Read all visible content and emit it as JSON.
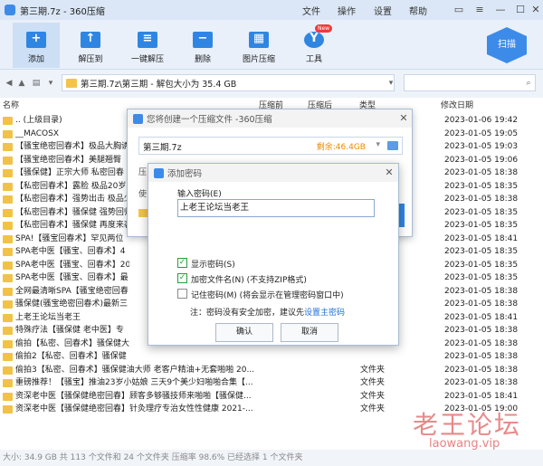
{
  "window": {
    "title": "第三期.7z - 360压缩",
    "menu": [
      "文件",
      "操作",
      "设置",
      "帮助"
    ]
  },
  "toolbar": {
    "buttons": [
      "添加",
      "解压到",
      "一键解压",
      "删除",
      "图片压缩",
      "工具"
    ],
    "new_badge": "New",
    "scan_label": "扫描"
  },
  "address": {
    "path": "第三期.7z\\第三期 - 解包大小为 35.4 GB"
  },
  "list": {
    "headers": [
      "名称",
      "压缩前",
      "压缩后",
      "类型",
      "修改日期"
    ],
    "rows": [
      {
        "name": ".. (上级目录)",
        "type": "",
        "date": "2023-01-06 19:42"
      },
      {
        "name": "__MACOSX",
        "type": "",
        "date": "2023-01-05 19:05"
      },
      {
        "name": "【骚宝绝密回春术】极品大胸诱",
        "type": "",
        "date": "2023-01-05 19:03"
      },
      {
        "name": "【骚宝绝密回春术】美腿翘臀",
        "type": "",
        "date": "2023-01-05 19:06"
      },
      {
        "name": "【骚保健】正宗大师 私密回春",
        "type": "",
        "date": "2023-01-05 18:38"
      },
      {
        "name": "【私密回春术】露脸 极品20岁",
        "type": "",
        "date": "2023-01-05 18:35"
      },
      {
        "name": "【私密回春术】强势出击 极品少",
        "type": "",
        "date": "2023-01-05 18:38"
      },
      {
        "name": "【私密回春术】骚保健 强势回归",
        "type": "",
        "date": "2023-01-05 18:35"
      },
      {
        "name": "【私密回春术】骚保健 再度来袭",
        "type": "",
        "date": "2023-01-05 18:35"
      },
      {
        "name": "SPA!【骚宝回春术】罕见两位",
        "type": "",
        "date": "2023-01-05 18:41"
      },
      {
        "name": "SPA老中医【骚宝、回春术】4",
        "type": "",
        "date": "2023-01-05 18:35"
      },
      {
        "name": "SPA老中医【骚宝、回春术】20",
        "type": "",
        "date": "2023-01-05 18:35"
      },
      {
        "name": "SPA老中医【骚宝、回春术】最",
        "type": "",
        "date": "2023-01-05 18:35"
      },
      {
        "name": "全网最清晰SPA【骚宝绝密回春",
        "type": "",
        "date": "2023-01-05 18:38"
      },
      {
        "name": "骚保健(骚宝绝密回春术)最新三",
        "type": "",
        "date": "2023-01-05 18:38"
      },
      {
        "name": "上老王论坛当老王",
        "type": "",
        "date": "2023-01-05 18:41"
      },
      {
        "name": "特殊疗法【骚保健 老中医】专",
        "type": "",
        "date": "2023-01-05 18:38"
      },
      {
        "name": "偷拍【私密、回春术】骚保健大",
        "type": "",
        "date": "2023-01-05 18:38"
      },
      {
        "name": "偷拍2【私密、回春术】骚保健",
        "type": "",
        "date": "2023-01-05 18:38"
      },
      {
        "name": "偷拍3【私密、回春术】骚保健油大师 老客户精油+无套啪啪 20...",
        "type": "文件夹",
        "date": "2023-01-05 18:38"
      },
      {
        "name": "重磅推荐！【骚宝】推油23岁小姑娘 三天9个美少妇啪啪合集【...",
        "type": "文件夹",
        "date": "2023-01-05 18:38"
      },
      {
        "name": "资深老中医【骚保健绝密回春】顾客多够骚技师来啪啪【骚保健...",
        "type": "文件夹",
        "date": "2023-01-05 18:41"
      },
      {
        "name": "资深老中医【骚保健绝密回春】针灸理疗专治女性性健康 2021-...",
        "type": "文件夹",
        "date": "2023-01-05 19:00"
      }
    ]
  },
  "status": {
    "text": "大小: 34.9 GB 共 113 个文件和 24 个文件夹 压缩率 98.6% 已经选择 1 个文件夹"
  },
  "watermark": {
    "line1": "老王论坛",
    "line2": "laowang.vip"
  },
  "create_dialog": {
    "title": "您将创建一个压缩文件 -360压缩",
    "filename": "第三期.7z",
    "remaining": "剩余:46.4GB",
    "side_labels": [
      "压",
      "使"
    ]
  },
  "password_dialog": {
    "title": "添加密码",
    "input_label": "输入密码(E)",
    "password_value": "上老王论坛当老王",
    "options": [
      {
        "label": "显示密码(S)",
        "checked": true
      },
      {
        "label": "加密文件名(N) (不支持ZIP格式)",
        "checked": true
      },
      {
        "label": "记住密码(M) (将会显示在管理密码窗口中)",
        "checked": false
      }
    ],
    "note": "注：密码没有安全加密，建议先",
    "note_link": "设置主密码",
    "ok": "确认",
    "cancel": "取消"
  }
}
